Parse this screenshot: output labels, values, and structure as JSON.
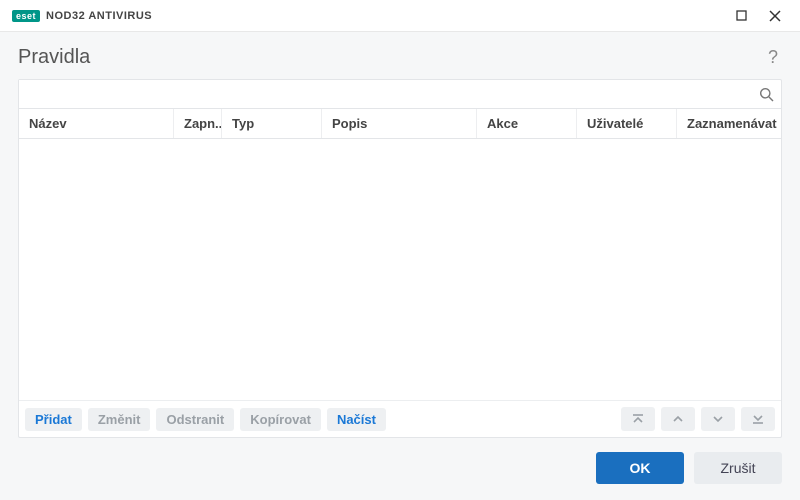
{
  "brand": {
    "badge": "eset",
    "product": "NOD32 ANTIVIRUS"
  },
  "page": {
    "title": "Pravidla",
    "help": "?"
  },
  "search": {
    "value": "",
    "placeholder": ""
  },
  "columns": {
    "name": "Název",
    "enabled": "Zapn...",
    "type": "Typ",
    "description": "Popis",
    "action": "Akce",
    "users": "Uživatelé",
    "log": "Zaznamenávat ..."
  },
  "rows": [],
  "toolbar": {
    "add": "Přidat",
    "edit": "Změnit",
    "delete": "Odstranit",
    "copy": "Kopírovat",
    "load": "Načíst"
  },
  "footer": {
    "ok": "OK",
    "cancel": "Zrušit"
  }
}
